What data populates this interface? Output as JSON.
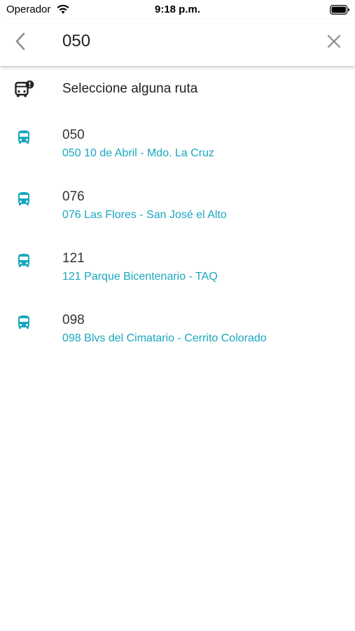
{
  "status_bar": {
    "carrier": "Operador",
    "time": "9:18 p.m."
  },
  "search": {
    "query": "050"
  },
  "prompt": {
    "label": "Seleccione alguna ruta",
    "icon": "bus-alert-icon"
  },
  "routes": [
    {
      "number": "050",
      "name": "050 10 de Abril - Mdo. La Cruz",
      "icon": "bus-icon"
    },
    {
      "number": "076",
      "name": "076 Las Flores - San José el Alto",
      "icon": "bus-icon"
    },
    {
      "number": "121",
      "name": "121 Parque Bicentenario - TAQ",
      "icon": "bus-icon"
    },
    {
      "number": "098",
      "name": "098 Blvs del Cimatario - Cerrito Colorado",
      "icon": "bus-icon"
    }
  ],
  "colors": {
    "accent": "#1aa7bf",
    "text": "#222222",
    "icon_gray": "#8e8e8e"
  }
}
